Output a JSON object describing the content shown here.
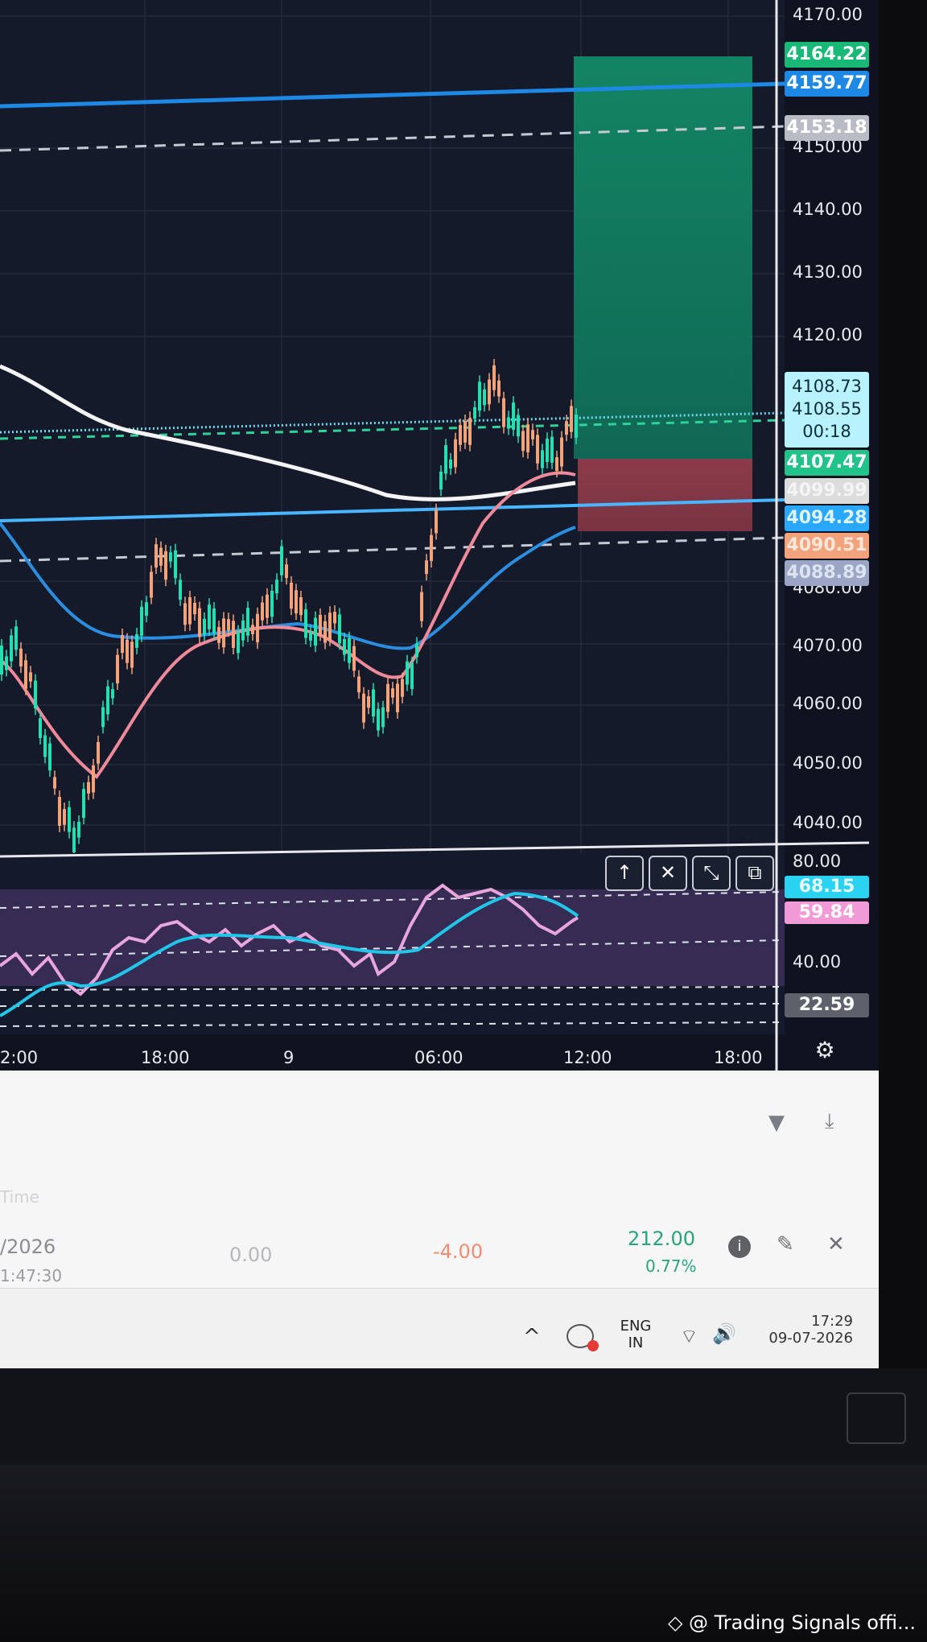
{
  "price_axis": {
    "ticks": [
      "4170.00",
      "4150.00",
      "4140.00",
      "4130.00",
      "4120.00",
      "4080.00",
      "4070.00",
      "4060.00",
      "4050.00",
      "4040.00"
    ],
    "labels": {
      "tp": "4164.22",
      "line_high": "4159.77",
      "dashed_high": "4153.18",
      "current_a": "4108.73",
      "current_b": "4108.55",
      "countdown": "00:18",
      "entry": "4107.47",
      "ma_white": "4099.99",
      "level_low": "4094.28",
      "dashed_low": "4090.51",
      "ma_blue": "4088.89"
    },
    "colors": {
      "tp": "#18b877",
      "line_high": "#1e88e5",
      "dashed_high": "#b9bcc4",
      "current": "#b8f2ff",
      "entry": "#21c38a",
      "ma_white": "#dcdcdc",
      "level_low": "#29a8ff",
      "dashed_low": "#f2a37b",
      "ma_blue": "#9aa6c4"
    }
  },
  "rsi_axis": {
    "ticks": [
      "80.00",
      "40.00"
    ],
    "labels": {
      "rsi": "68.15",
      "ma": "59.84",
      "low": "22.59"
    },
    "colors": {
      "rsi": "#2ad3f2",
      "ma": "#f29ad7",
      "low": "#5c616b"
    }
  },
  "time_axis": {
    "ticks": [
      "2:00",
      "18:00",
      "9",
      "06:00",
      "12:00",
      "18:00"
    ]
  },
  "controls": [
    "↑",
    "✕",
    "⤡",
    "⧉"
  ],
  "settings_icon": "⚙",
  "positions_panel": {
    "header_time": "Time",
    "row": {
      "date": "/2026",
      "time": "1:47:30",
      "value1": "0.00",
      "value2": "-4.00",
      "profit": "212.00",
      "profit_pct": "0.77%"
    }
  },
  "taskbar": {
    "lang_top": "ENG",
    "lang_bottom": "IN",
    "clock_time": "17:29",
    "clock_date": "09-07-2026"
  },
  "watermark": "@ Trading Signals offi..."
}
